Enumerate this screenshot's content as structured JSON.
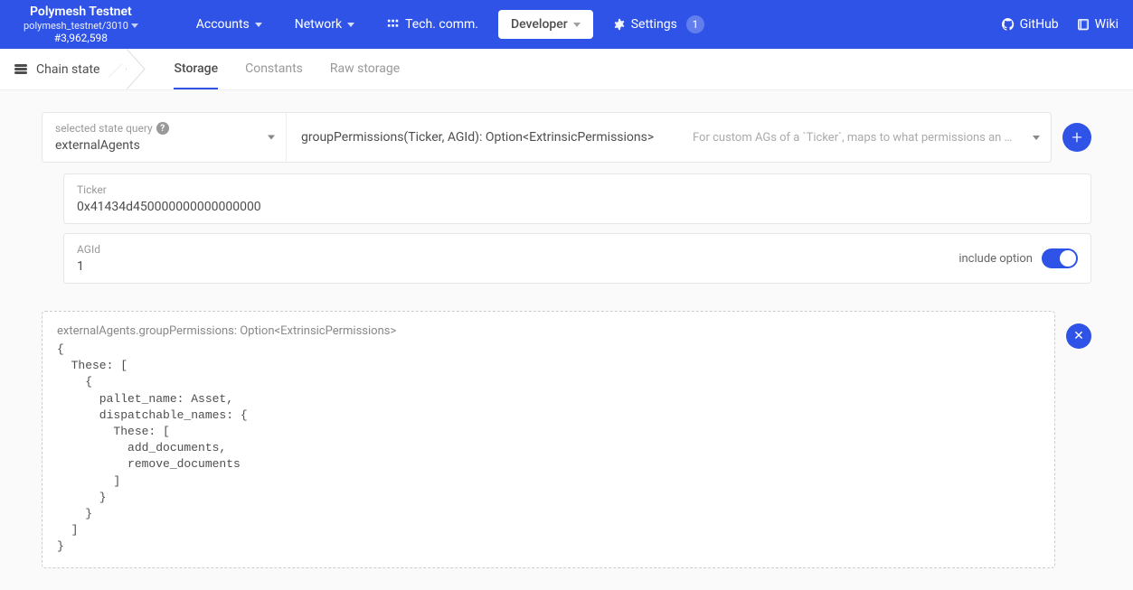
{
  "network": {
    "name": "Polymesh Testnet",
    "endpoint": "polymesh_testnet/3010",
    "block": "#3,962,598"
  },
  "nav": {
    "accounts": "Accounts",
    "network": "Network",
    "tech_comm": "Tech. comm.",
    "developer": "Developer",
    "settings": "Settings",
    "settings_badge": "1",
    "github": "GitHub",
    "wiki": "Wiki"
  },
  "subnav": {
    "title": "Chain state",
    "tabs": {
      "storage": "Storage",
      "constants": "Constants",
      "raw": "Raw storage"
    }
  },
  "query": {
    "label": "selected state query",
    "module": "externalAgents",
    "method": "groupPermissions(Ticker, AGId): Option<ExtrinsicPermissions>",
    "description": "For custom AGs of a `Ticker`, maps to what permissions an age…"
  },
  "params": {
    "ticker": {
      "label": "Ticker",
      "value": "0x41434d450000000000000000"
    },
    "agid": {
      "label": "AGId",
      "value": "1",
      "toggle_label": "include option"
    }
  },
  "result": {
    "header": "externalAgents.groupPermissions: Option<ExtrinsicPermissions>",
    "body": "{\n  These: [\n    {\n      pallet_name: Asset,\n      dispatchable_names: {\n        These: [\n          add_documents,\n          remove_documents\n        ]\n      }\n    }\n  ]\n}"
  }
}
